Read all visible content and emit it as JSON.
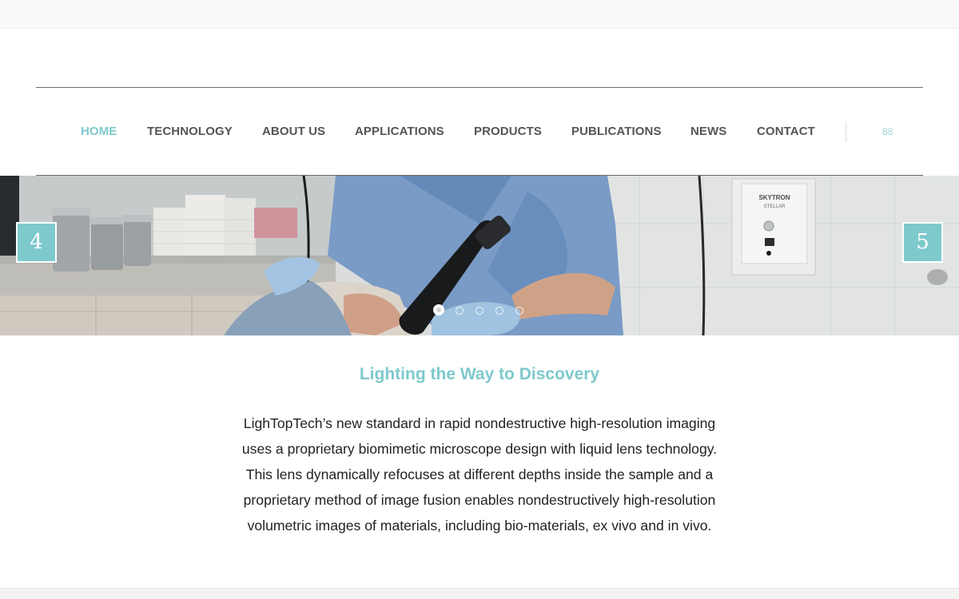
{
  "nav": {
    "items": [
      {
        "label": "HOME",
        "active": true
      },
      {
        "label": "TECHNOLOGY",
        "active": false
      },
      {
        "label": "ABOUT US",
        "active": false
      },
      {
        "label": "APPLICATIONS",
        "active": false
      },
      {
        "label": "PRODUCTS",
        "active": false
      },
      {
        "label": "PUBLICATIONS",
        "active": false
      },
      {
        "label": "NEWS",
        "active": false
      },
      {
        "label": "CONTACT",
        "active": false
      }
    ],
    "search_toggle_label": "88"
  },
  "slider": {
    "prev_label": "4",
    "next_label": "5",
    "slide_count": 5,
    "active_slide": 1,
    "image_description_icon": "clinic-scan-photo",
    "equipment_label": "SKYTRON\nSTELLAR"
  },
  "content": {
    "headline": "Lighting the Way to Discovery",
    "paragraph": "LighTopTech’s new standard in rapid nondestructive high-resolution imaging uses a proprietary biomimetic microscope design with liquid lens technology. This lens dynamically refocuses at different depths inside the sample and a proprietary method of image fusion enables nondestructively high-resolution volumetric images of materials, including bio-materials, ex vivo and in vivo."
  },
  "colors": {
    "accent": "#7ec9cc",
    "nav_text": "#555555",
    "body_text": "#222222",
    "rule": "#6b6b6b"
  }
}
